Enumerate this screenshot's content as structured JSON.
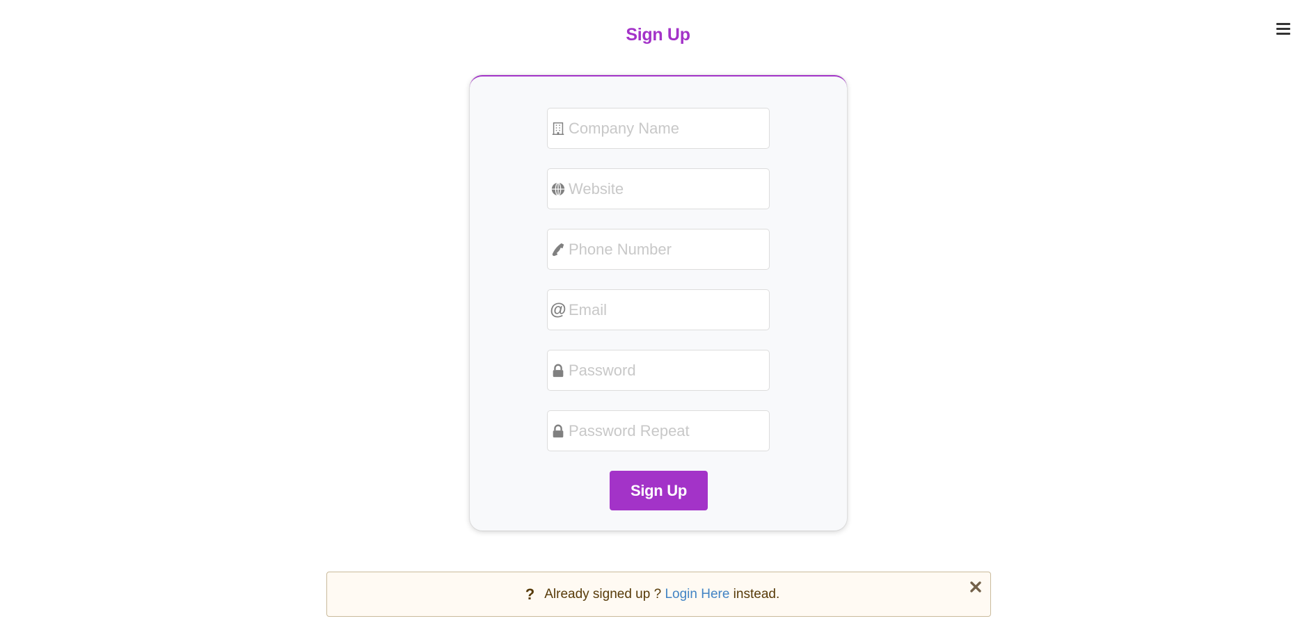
{
  "page": {
    "title": "Sign Up",
    "menu_icon": "hamburger-menu-icon"
  },
  "form": {
    "fields": [
      {
        "name": "company-name",
        "icon": "building-icon",
        "placeholder": "Company Name",
        "value": "",
        "type": "text"
      },
      {
        "name": "website",
        "icon": "globe-icon",
        "placeholder": "Website",
        "value": "",
        "type": "text"
      },
      {
        "name": "phone-number",
        "icon": "phone-icon",
        "placeholder": "Phone Number",
        "value": "",
        "type": "tel"
      },
      {
        "name": "email",
        "icon": "at-icon",
        "placeholder": "Email",
        "value": "",
        "type": "email"
      },
      {
        "name": "password",
        "icon": "lock-icon",
        "placeholder": "Password",
        "value": "",
        "type": "password"
      },
      {
        "name": "password-repeat",
        "icon": "lock-icon",
        "placeholder": "Password Repeat",
        "value": "",
        "type": "password"
      }
    ],
    "submit_label": "Sign Up"
  },
  "message": {
    "icon": "question-icon",
    "icon_glyph": "?",
    "text_before": "Already signed up ? ",
    "link_text": "Login Here",
    "text_after": " instead.",
    "close_icon": "close-icon"
  },
  "colors": {
    "accent": "#a333c8",
    "link": "#4183c4",
    "message_bg": "#fffaf3",
    "message_text": "#573a08"
  }
}
